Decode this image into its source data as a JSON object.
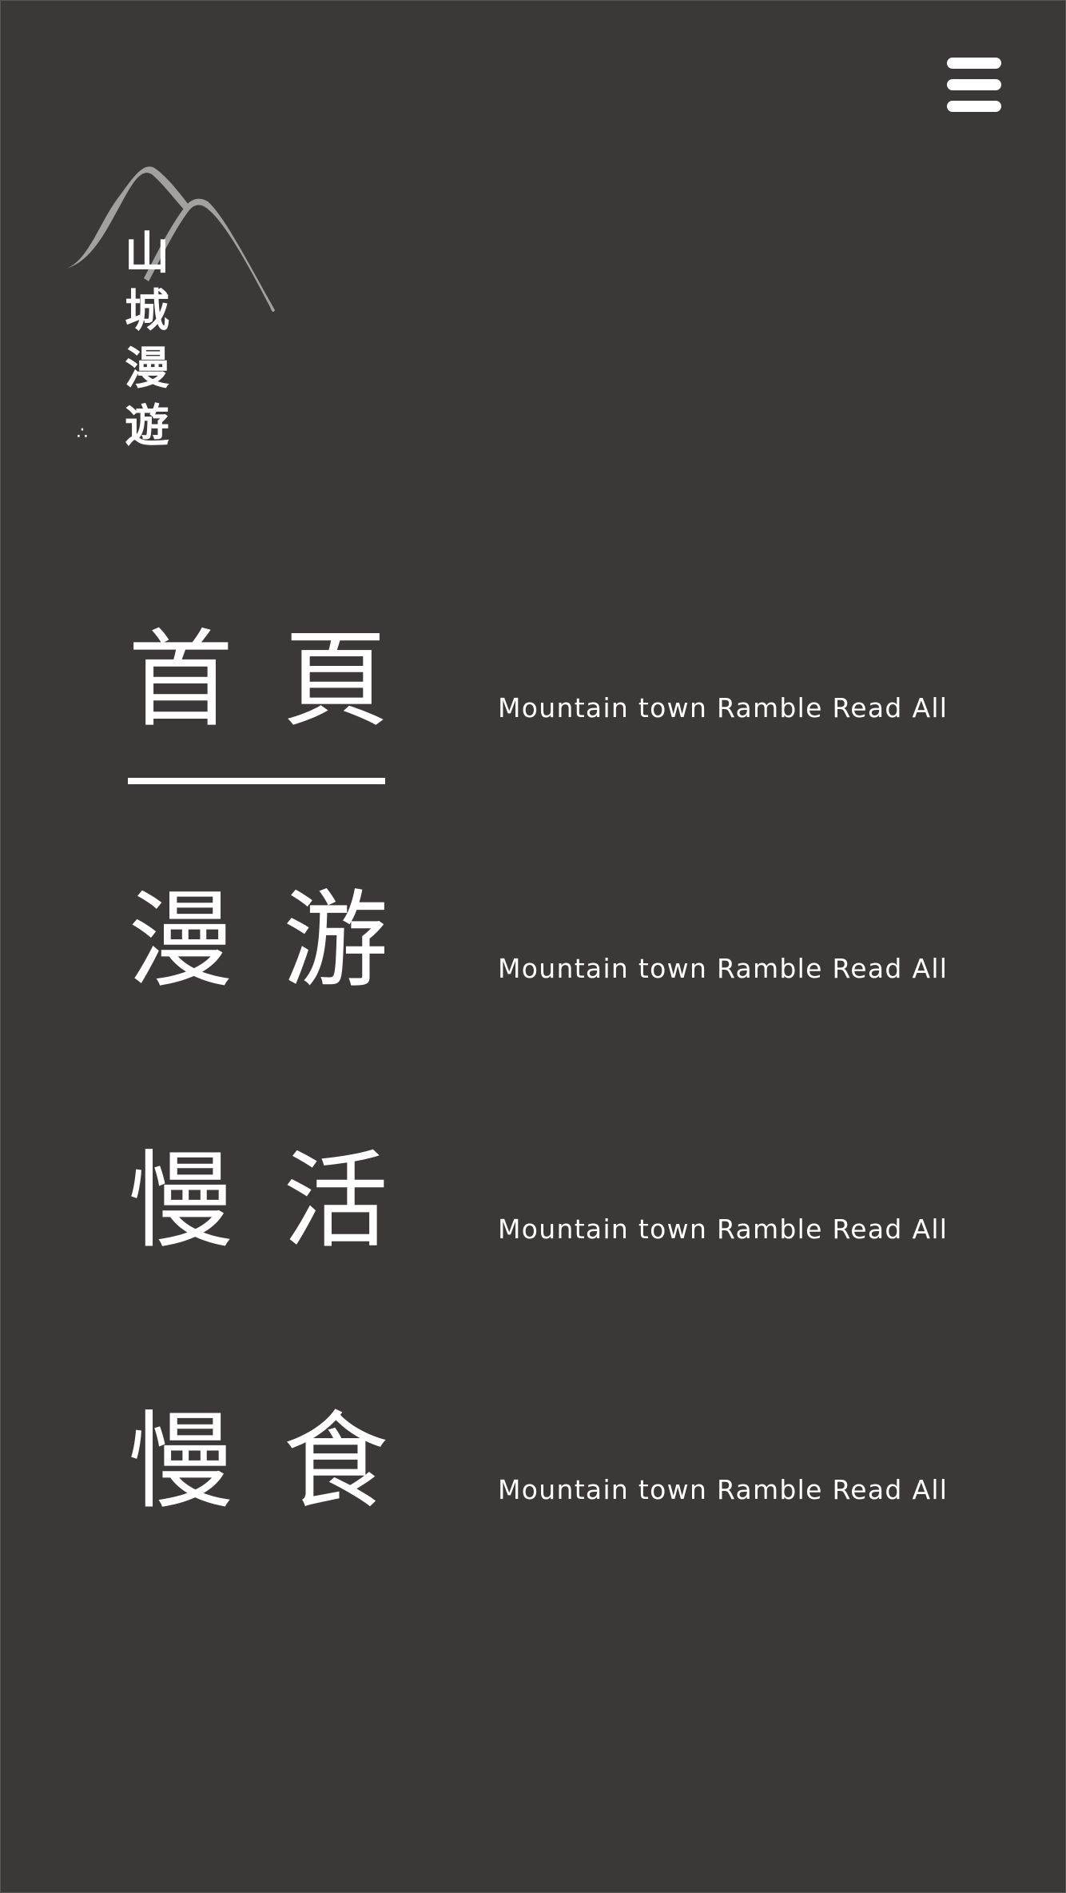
{
  "logo": {
    "text": "山\n城\n漫\n遊",
    "dots": "∴",
    "mountain_color": "#a3a1a0"
  },
  "header": {
    "menu_icon": "hamburger-menu-icon"
  },
  "nav": {
    "items": [
      {
        "title": "首頁",
        "subtitle": "Mountain town Ramble Read All",
        "active": true
      },
      {
        "title": "漫游",
        "subtitle": "Mountain town Ramble Read All",
        "active": false
      },
      {
        "title": "慢活",
        "subtitle": "Mountain town Ramble Read All",
        "active": false
      },
      {
        "title": "慢食",
        "subtitle": "Mountain town Ramble Read All",
        "active": false
      }
    ]
  },
  "colors": {
    "background": "#3c3837",
    "foreground": "#ffffff"
  }
}
